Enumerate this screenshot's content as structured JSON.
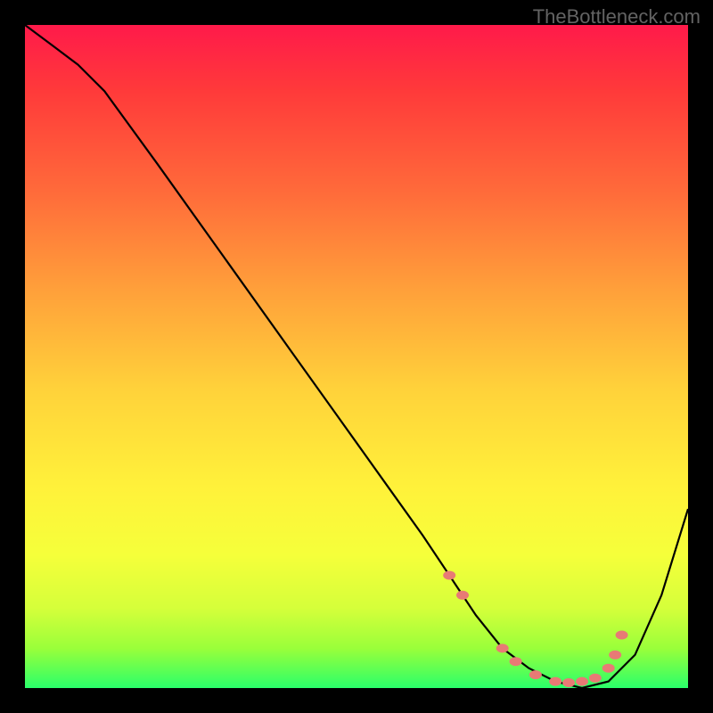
{
  "watermark": "TheBottleneck.com",
  "chart_data": {
    "type": "line",
    "title": "",
    "xlabel": "",
    "ylabel": "",
    "xlim": [
      0,
      100
    ],
    "ylim": [
      0,
      100
    ],
    "grid": false,
    "series": [
      {
        "name": "curve",
        "x": [
          0,
          4,
          8,
          12,
          20,
          30,
          40,
          50,
          55,
          60,
          64,
          68,
          72,
          76,
          80,
          84,
          88,
          92,
          96,
          100
        ],
        "y": [
          100,
          97,
          94,
          90,
          79,
          65,
          51,
          37,
          30,
          23,
          17,
          11,
          6,
          3,
          1,
          0,
          1,
          5,
          14,
          27
        ]
      }
    ],
    "markers": [
      {
        "x": 64,
        "y": 17
      },
      {
        "x": 66,
        "y": 14
      },
      {
        "x": 72,
        "y": 6
      },
      {
        "x": 74,
        "y": 4
      },
      {
        "x": 77,
        "y": 2
      },
      {
        "x": 80,
        "y": 1
      },
      {
        "x": 82,
        "y": 0.8
      },
      {
        "x": 84,
        "y": 1
      },
      {
        "x": 86,
        "y": 1.5
      },
      {
        "x": 88,
        "y": 3
      },
      {
        "x": 89,
        "y": 5
      },
      {
        "x": 90,
        "y": 8
      }
    ],
    "gradient_stops": [
      {
        "pos": 0,
        "color": "#ff1a4a"
      },
      {
        "pos": 25,
        "color": "#ff6a3a"
      },
      {
        "pos": 55,
        "color": "#ffd23a"
      },
      {
        "pos": 80,
        "color": "#f5ff3a"
      },
      {
        "pos": 100,
        "color": "#2aff6a"
      }
    ]
  }
}
